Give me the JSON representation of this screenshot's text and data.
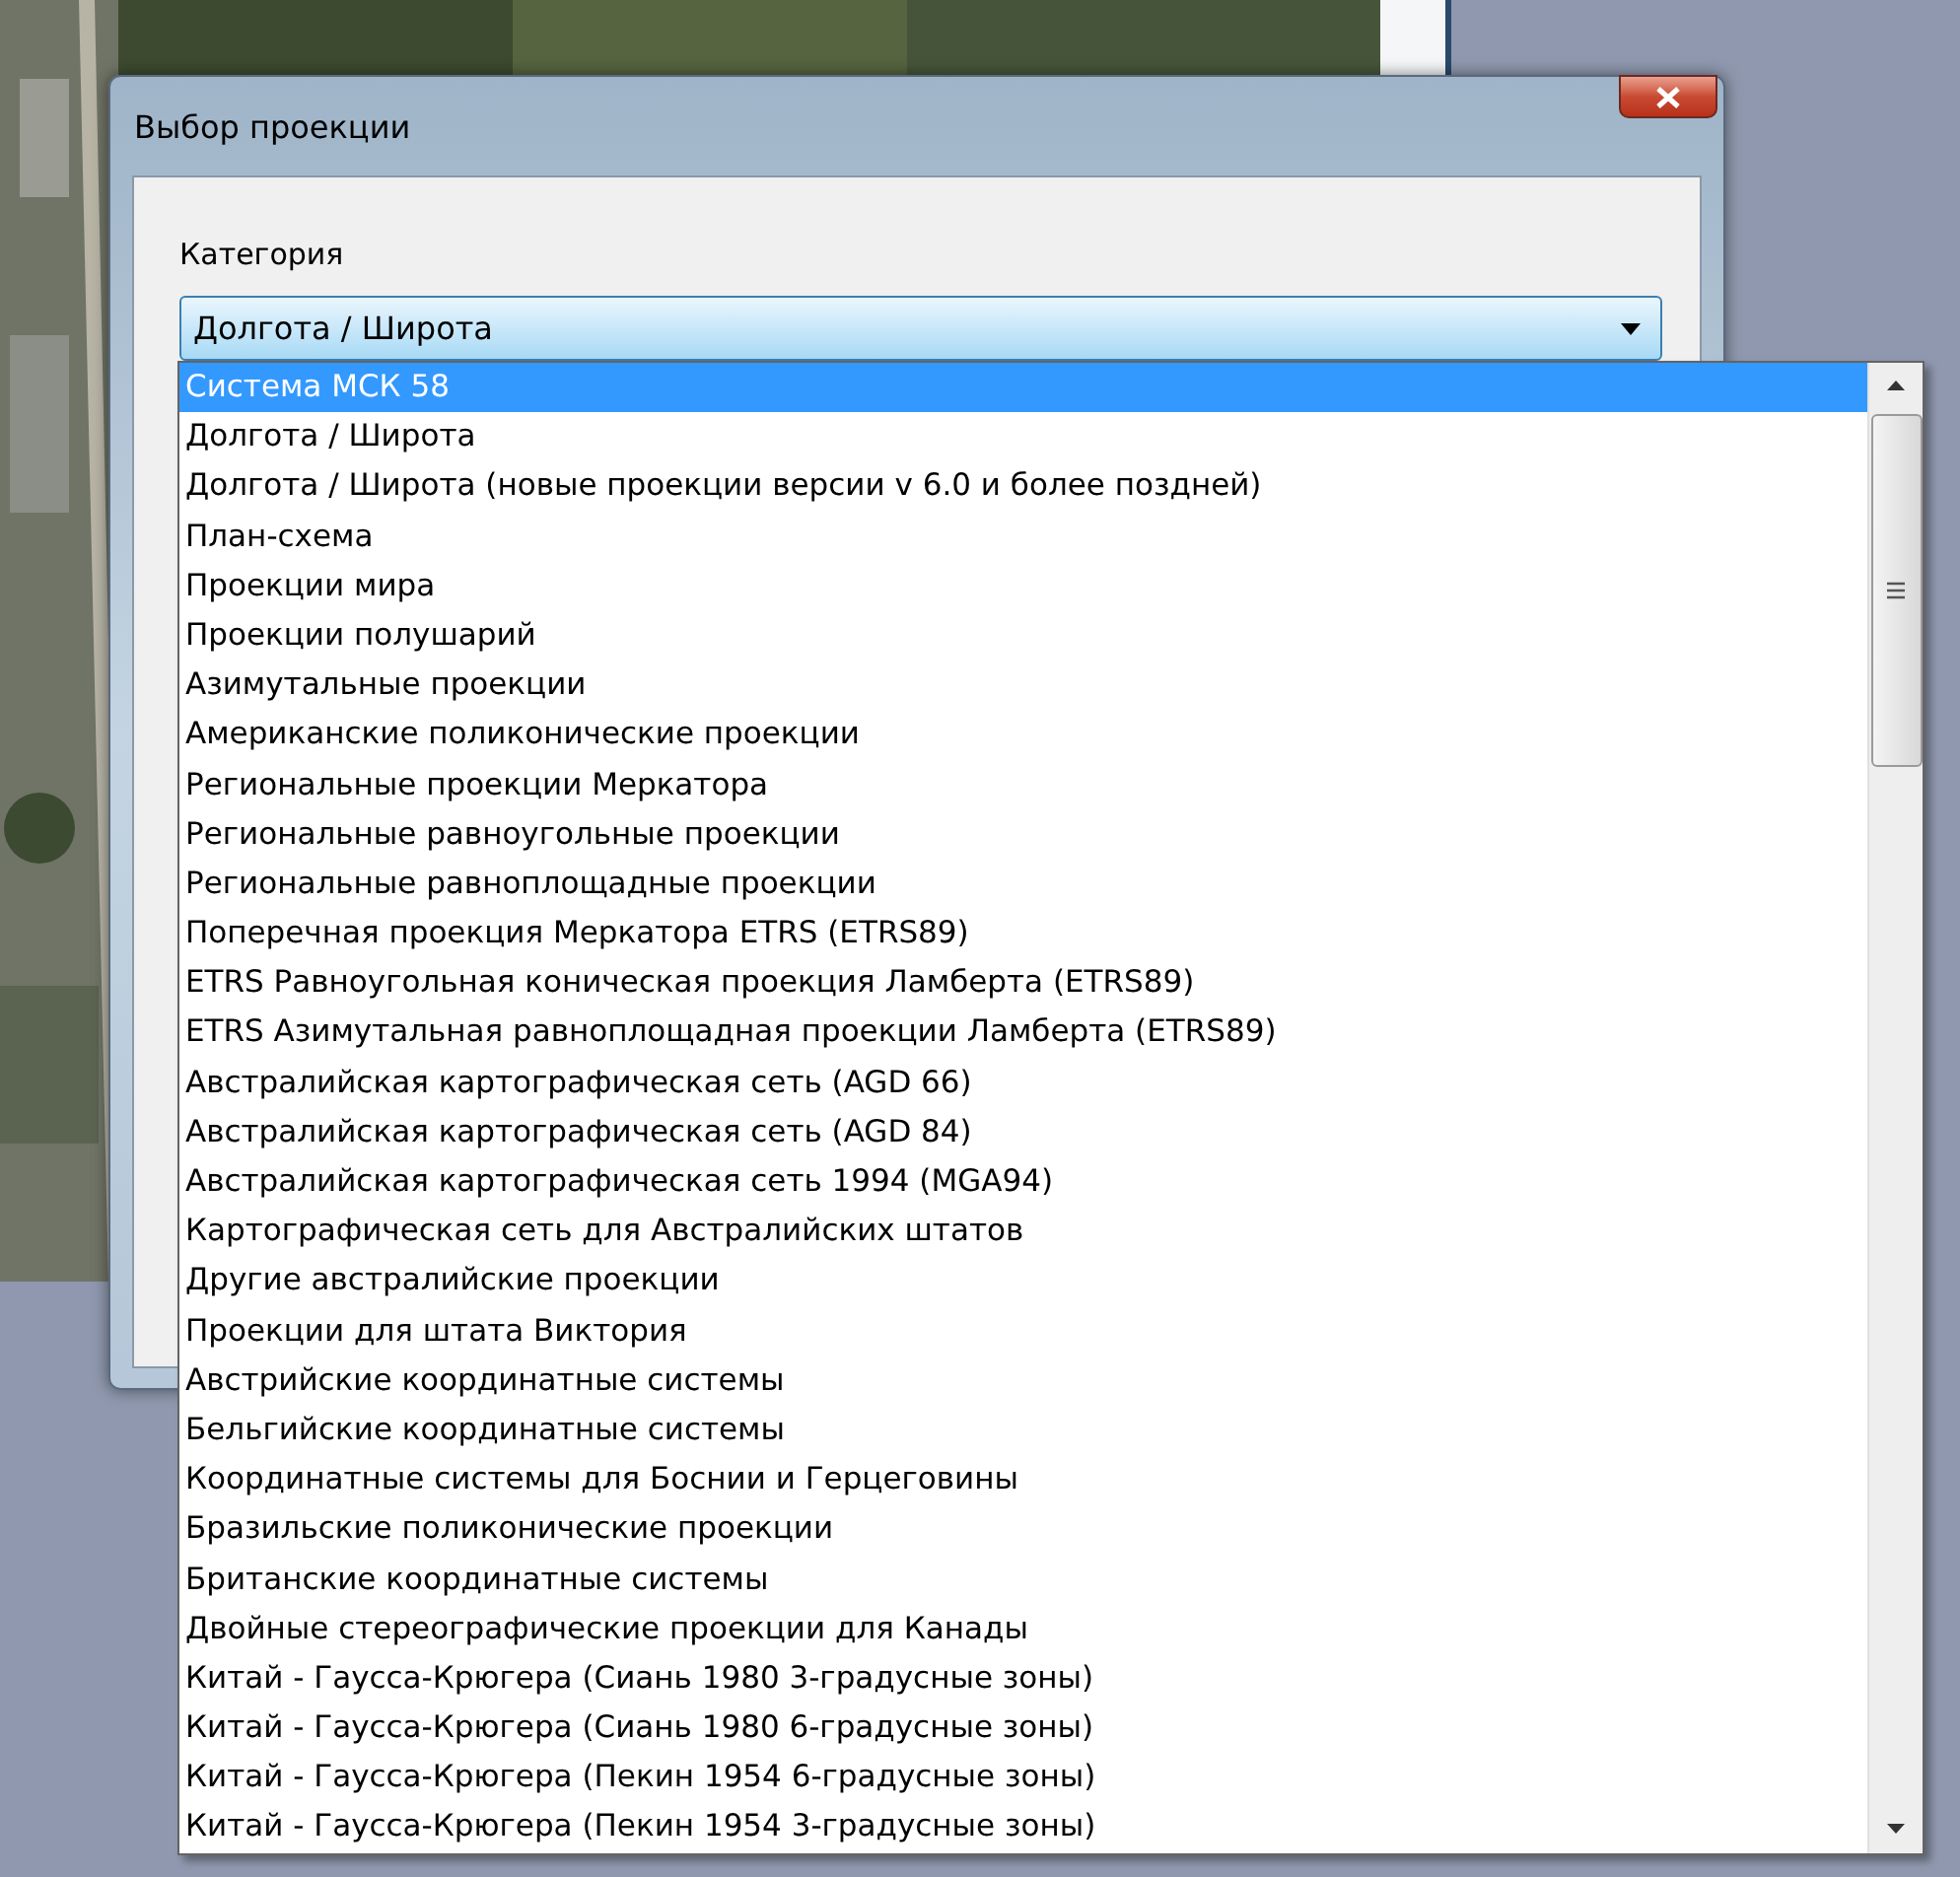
{
  "dialog": {
    "title": "Выбор проекции",
    "category_label": "Категория",
    "category_value": "Долгота / Широта"
  },
  "dropdown": {
    "items": [
      {
        "label": "Система МСК 58",
        "selected": true
      },
      {
        "label": "Долгота / Широта",
        "selected": false
      },
      {
        "label": "Долгота / Широта (новые проекции версии v 6.0 и более поздней)",
        "selected": false
      },
      {
        "label": "План-схема",
        "selected": false
      },
      {
        "label": "Проекции мира",
        "selected": false
      },
      {
        "label": "Проекции полушарий",
        "selected": false
      },
      {
        "label": "Азимутальные проекции",
        "selected": false
      },
      {
        "label": "Американские поликонические проекции",
        "selected": false
      },
      {
        "label": "Региональные проекции Меркатора",
        "selected": false
      },
      {
        "label": "Региональные равноугольные проекции",
        "selected": false
      },
      {
        "label": "Региональные равноплощадные проекции",
        "selected": false
      },
      {
        "label": "Поперечная проекция Меркатора ETRS (ETRS89)",
        "selected": false
      },
      {
        "label": "ETRS Равноугольная коническая проекция Ламберта (ETRS89)",
        "selected": false
      },
      {
        "label": "ETRS Азимутальная равноплощадная проекции Ламберта (ETRS89)",
        "selected": false
      },
      {
        "label": "Австралийская картографическая сеть (AGD 66)",
        "selected": false
      },
      {
        "label": "Австралийская картографическая сеть (AGD 84)",
        "selected": false
      },
      {
        "label": "Австралийская картографическая сеть 1994 (MGA94)",
        "selected": false
      },
      {
        "label": "Картографическая сеть для Австралийских штатов",
        "selected": false
      },
      {
        "label": "Другие австралийские проекции",
        "selected": false
      },
      {
        "label": "Проекции для штата Виктория",
        "selected": false
      },
      {
        "label": "Австрийские координатные системы",
        "selected": false
      },
      {
        "label": "Бельгийские координатные системы",
        "selected": false
      },
      {
        "label": "Координатные системы для Боснии и Герцеговины",
        "selected": false
      },
      {
        "label": "Бразильские поликонические проекции",
        "selected": false
      },
      {
        "label": "Британские координатные системы",
        "selected": false
      },
      {
        "label": "Двойные стереографические проекции для Канады",
        "selected": false
      },
      {
        "label": "Китай - Гаусса-Крюгера (Сиань 1980 3-градусные зоны)",
        "selected": false
      },
      {
        "label": "Китай - Гаусса-Крюгера (Сиань 1980 6-градусные зоны)",
        "selected": false
      },
      {
        "label": "Китай - Гаусса-Крюгера (Пекин 1954 6-градусные зоны)",
        "selected": false
      },
      {
        "label": "Китай - Гаусса-Крюгера (Пекин 1954 3-градусные зоны)",
        "selected": false
      }
    ]
  }
}
